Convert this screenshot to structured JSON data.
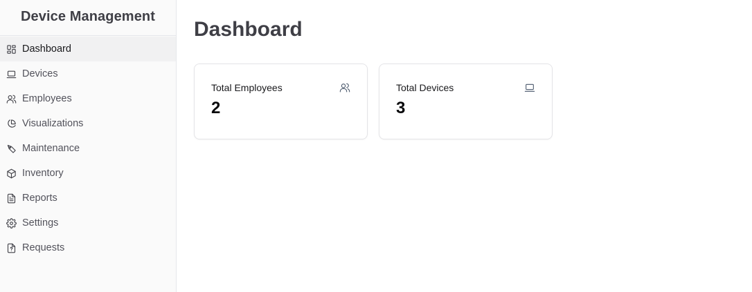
{
  "app": {
    "title": "Device Management"
  },
  "sidebar": {
    "items": [
      {
        "label": "Dashboard",
        "icon": "dashboard-icon",
        "active": true
      },
      {
        "label": "Devices",
        "icon": "laptop-icon"
      },
      {
        "label": "Employees",
        "icon": "users-icon"
      },
      {
        "label": "Visualizations",
        "icon": "pie-chart-icon"
      },
      {
        "label": "Maintenance",
        "icon": "wrench-icon"
      },
      {
        "label": "Inventory",
        "icon": "box-icon"
      },
      {
        "label": "Reports",
        "icon": "document-icon"
      },
      {
        "label": "Settings",
        "icon": "gear-icon"
      },
      {
        "label": "Requests",
        "icon": "help-file-icon"
      }
    ]
  },
  "main": {
    "title": "Dashboard",
    "cards": [
      {
        "label": "Total Employees",
        "value": "2",
        "icon": "users-icon"
      },
      {
        "label": "Total Devices",
        "value": "3",
        "icon": "laptop-icon"
      }
    ]
  }
}
